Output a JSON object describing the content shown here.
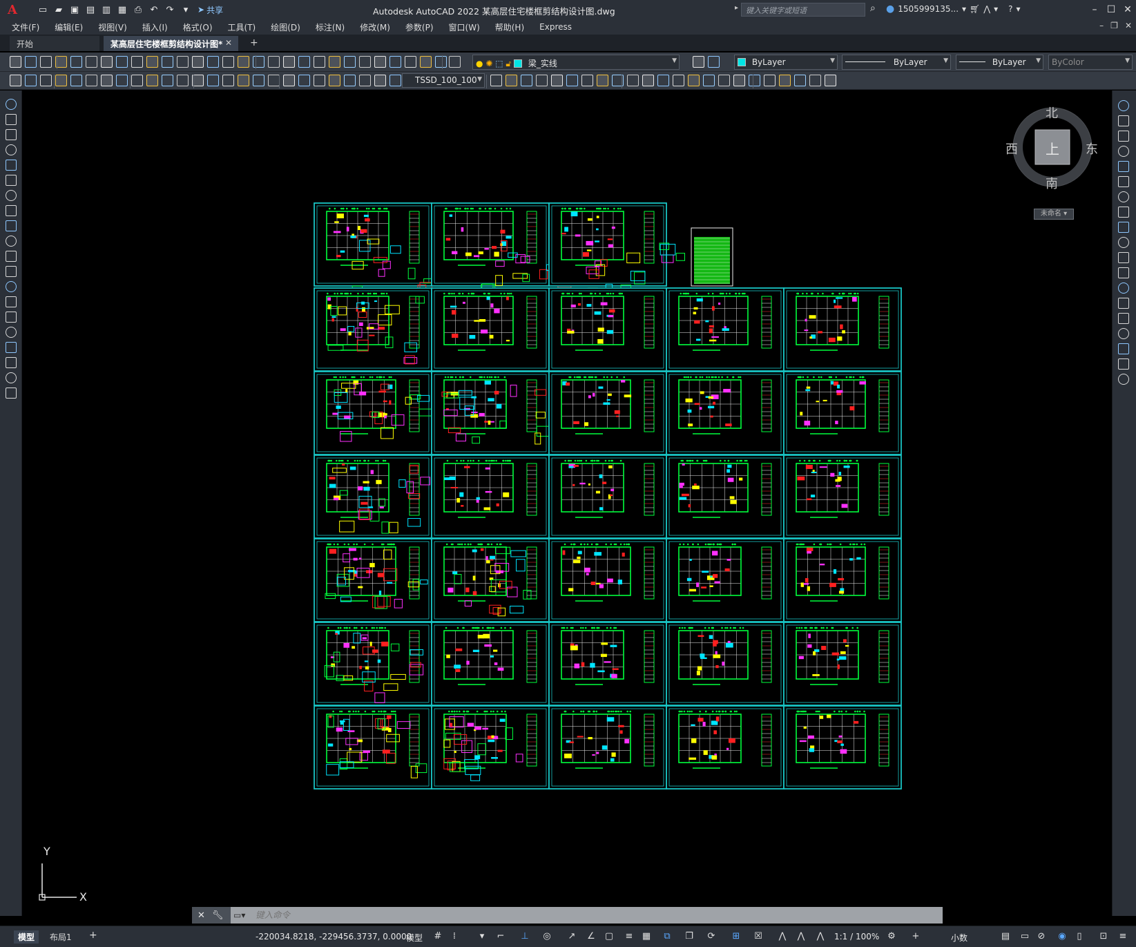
{
  "app": {
    "logo": "A",
    "title": "Autodesk AutoCAD 2022    某高层住宅楼框剪结构设计图.dwg",
    "share_label": "共享",
    "search_placeholder": "键入关键字或短语",
    "user_name": "1505999135...",
    "window_controls": [
      "minimize",
      "maximize",
      "close"
    ]
  },
  "menu": {
    "items": [
      "文件(F)",
      "编辑(E)",
      "视图(V)",
      "插入(I)",
      "格式(O)",
      "工具(T)",
      "绘图(D)",
      "标注(N)",
      "修改(M)",
      "参数(P)",
      "窗口(W)",
      "帮助(H)",
      "Express"
    ]
  },
  "tabs": {
    "start": "开始",
    "drawing": "某高层住宅楼框剪结构设计图*",
    "close_glyph": "✕",
    "add_glyph": "+"
  },
  "toolbar": {
    "layer_name": "梁_实线",
    "layer_color": "#00e5e5",
    "color_value": "ByLayer",
    "color_swatch": "#00e5e5",
    "linetype_value": "ByLayer",
    "lineweight_value": "ByLayer",
    "plotstyle_value": "ByColor",
    "dimstyle_value": "TSSD_100_100"
  },
  "viewcube": {
    "top": "上",
    "north": "北",
    "south": "南",
    "east": "东",
    "west": "西",
    "ucs_menu": "未命名"
  },
  "ucs": {
    "x_label": "X",
    "y_label": "Y"
  },
  "command_line": {
    "placeholder": "键入命令"
  },
  "status": {
    "model_tab": "模型",
    "layout_tab": "布局1",
    "add_tab": "+",
    "coordinates": "-220034.8218, -229456.3737, 0.0000",
    "space": "模型",
    "annotation_scale": "1:1 / 100%",
    "units": "小数"
  },
  "colors": {
    "sheet_border": "#18c4c4",
    "canvas": "#000000",
    "chrome": "#2b3038"
  }
}
